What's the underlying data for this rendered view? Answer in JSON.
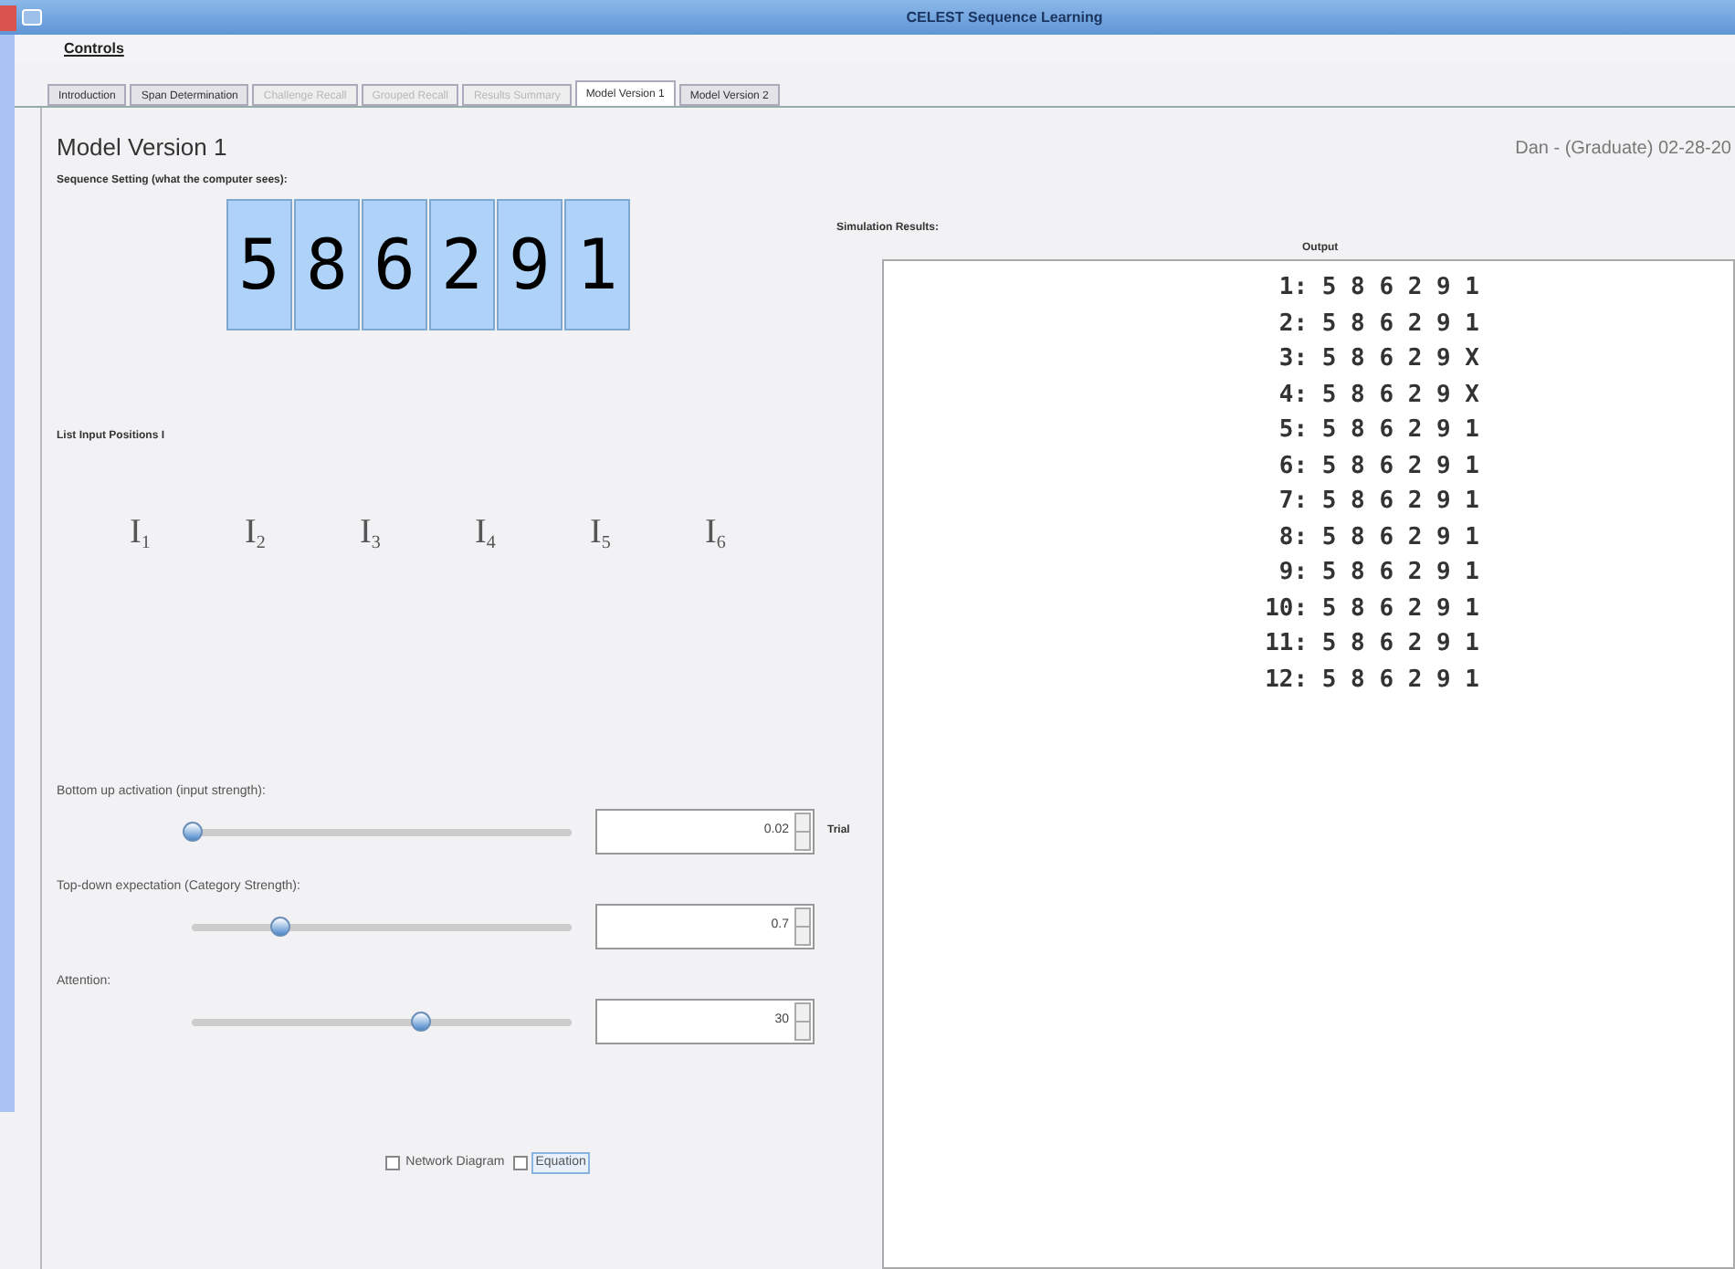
{
  "window": {
    "title": "CELEST Sequence Learning"
  },
  "menu": [
    "Controls"
  ],
  "tabs": [
    {
      "label": "Introduction",
      "selected": false,
      "disabled": false
    },
    {
      "label": "Span Determination",
      "selected": false,
      "disabled": false
    },
    {
      "label": "Challenge Recall",
      "selected": false,
      "disabled": true
    },
    {
      "label": "Grouped Recall",
      "selected": false,
      "disabled": true
    },
    {
      "label": "Results Summary",
      "selected": false,
      "disabled": true
    },
    {
      "label": "Model Version 1",
      "selected": true,
      "disabled": false
    },
    {
      "label": "Model Version 2",
      "selected": false,
      "disabled": false
    }
  ],
  "panel": {
    "title": "Model Version 1",
    "user_info": "Dan - (Graduate)  02-28-20",
    "sequence_label": "Sequence Setting (what the computer sees):",
    "sequence": [
      "5",
      "8",
      "6",
      "2",
      "9",
      "1"
    ],
    "positions_label": "List Input Positions I",
    "positions": [
      "I$_{1}$",
      "I$_{2}$",
      "I$_{3}$",
      "I$_{4}$",
      "I$_{5}$",
      "I$_{6}$"
    ],
    "sliders": [
      {
        "label": "Bottom up activation (input strength):",
        "level": 0.0,
        "value": "0.02"
      },
      {
        "label": "Top-down expectation (Category Strength):",
        "level": 0.23,
        "value": "0.7"
      },
      {
        "label": "Attention:",
        "level": 0.6,
        "value": "30"
      }
    ],
    "trial_label": "Trial",
    "checkboxes": [
      {
        "label": "Network Diagram",
        "checked": false,
        "focused": false
      },
      {
        "label": "Equation",
        "checked": false,
        "focused": true
      }
    ]
  },
  "results": {
    "title": "Simulation Results:",
    "column": "Output",
    "lines": [
      "1: 5 8 6 2 9 1",
      "2: 5 8 6 2 9 1",
      "3: 5 8 6 2 9 X",
      "4: 5 8 6 2 9 X",
      "5: 5 8 6 2 9 1",
      "6: 5 8 6 2 9 1",
      "7: 5 8 6 2 9 1",
      "8: 5 8 6 2 9 1",
      "9: 5 8 6 2 9 1",
      "10: 5 8 6 2 9 1",
      "11: 5 8 6 2 9 1",
      "12: 5 8 6 2 9 1"
    ]
  }
}
